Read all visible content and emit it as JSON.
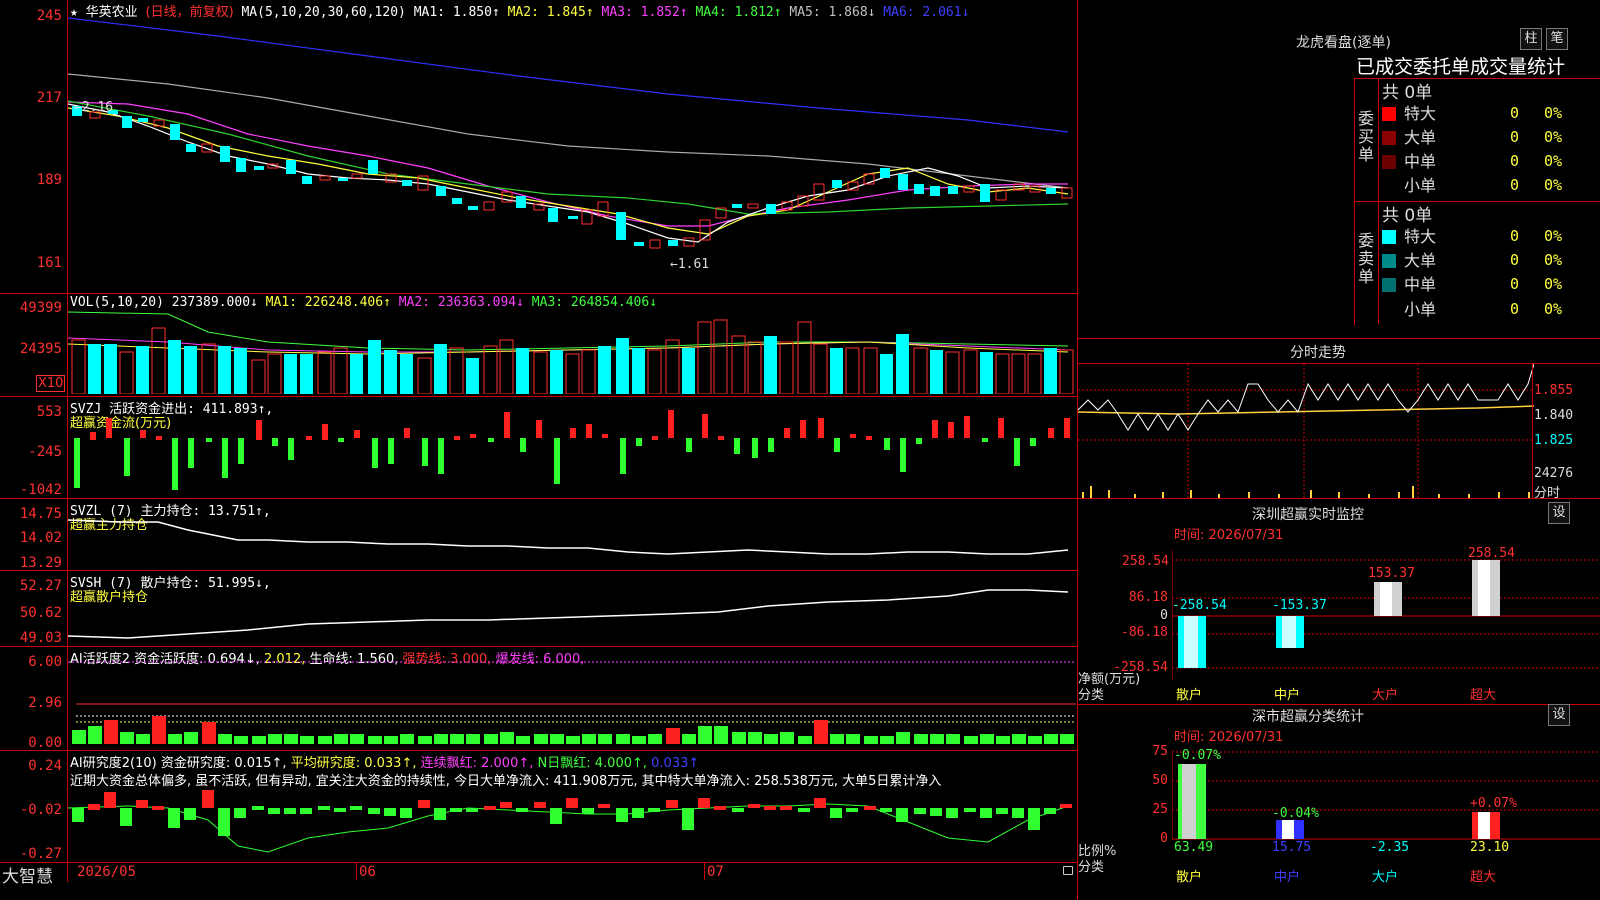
{
  "main_chart": {
    "stock_name": "华英农业",
    "period_note": "(日线，前复权)",
    "ma_label": "MA(5,10,20,30,60,120)",
    "ma_values": [
      {
        "text": "MA1: 1.850↑",
        "color": "#ffffff"
      },
      {
        "text": "MA2: 1.845↑",
        "color": "#ffff40"
      },
      {
        "text": "MA3: 1.852↑",
        "color": "#ff40ff"
      },
      {
        "text": "MA4: 1.812↑",
        "color": "#40ff40"
      },
      {
        "text": "MA5: 1.868↓",
        "color": "#c0c0c0"
      },
      {
        "text": "MA6: 2.061↓",
        "color": "#4040ff"
      }
    ],
    "y_labels": [
      "245",
      "217",
      "189",
      "161"
    ],
    "high_marker": "←2.16",
    "low_marker": "←1.61"
  },
  "vol_panel": {
    "title": "VOL(5,10,20)",
    "items": [
      {
        "text": "237389.000↓",
        "color": "#ffffff"
      },
      {
        "text": "MA1: 226248.406↑",
        "color": "#ffff40"
      },
      {
        "text": "MA2: 236363.094↓",
        "color": "#ff40ff"
      },
      {
        "text": "MA3: 264854.406↓",
        "color": "#40ff40"
      }
    ],
    "y_labels": [
      "49399",
      "24395"
    ],
    "unit": "X10"
  },
  "svzj_panel": {
    "title": "SVZJ  活跃资金进出: 411.893↑,",
    "subtitle": "超赢资金流(万元)",
    "y_labels": [
      "553",
      "-245",
      "-1042"
    ]
  },
  "svzl_panel": {
    "title": "SVZL (7) 主力持仓: 13.751↑,",
    "subtitle": "超赢主力持仓",
    "y_labels": [
      "14.75",
      "14.02",
      "13.29"
    ]
  },
  "svsh_panel": {
    "title": "SVSH (7) 散户持仓: 51.995↓,",
    "subtitle": "超赢散户持仓",
    "y_labels": [
      "52.27",
      "50.62",
      "49.03"
    ]
  },
  "ai_active_panel": {
    "title": "AI活跃度2 资金活跃度: 0.694↓,",
    "v2": "2.012,",
    "v3": "生命线: 1.560,",
    "v4": "强势线: 3.000,",
    "v5": "爆发线: 6.000,",
    "y_labels": [
      "6.00",
      "2.96",
      "0.00"
    ]
  },
  "ai_research_panel": {
    "title": "AI研究度2(10) 资金研究度: 0.015↑,",
    "v2": "平均研究度: 0.033↑,",
    "v3": "连续飘红: 2.000↑,",
    "v4": "N日飘红: 4.000↑,",
    "v5": "0.033↑",
    "comment": "近期大资金总体偏多, 虽不活跃, 但有异动, 宜关注大资金的持续性, 今日大单净流入: 411.908万元, 其中特大单净流入: 258.538万元, 大单5日累计净入",
    "y_labels": [
      "0.24",
      "-0.02",
      "-0.27"
    ]
  },
  "bottom_axis": {
    "brand": "大智慧",
    "dates": [
      "2026/05",
      "06",
      "07"
    ]
  },
  "right_panel": {
    "dragon_title": "龙虎看盘(逐单)",
    "btn_bar": "柱",
    "btn_pen": "笔",
    "stat_header": "已成交委托单成交量统计",
    "buy": {
      "side": "委买单",
      "count": "共 0单",
      "rows": [
        {
          "label": "特大",
          "value": "0",
          "pct": "0%",
          "color": "#ff0000"
        },
        {
          "label": "大单",
          "value": "0",
          "pct": "0%",
          "color": "#8b0000"
        },
        {
          "label": "中单",
          "value": "0",
          "pct": "0%",
          "color": "#6b0000"
        },
        {
          "label": "小单",
          "value": "0",
          "pct": "0%",
          "color": "#000000"
        }
      ]
    },
    "sell": {
      "side": "委卖单",
      "count": "共 0单",
      "rows": [
        {
          "label": "特大",
          "value": "0",
          "pct": "0%",
          "color": "#00ffff"
        },
        {
          "label": "大单",
          "value": "0",
          "pct": "0%",
          "color": "#008b8b"
        },
        {
          "label": "中单",
          "value": "0",
          "pct": "0%",
          "color": "#007070"
        },
        {
          "label": "小单",
          "value": "0",
          "pct": "0%",
          "color": "#000000"
        }
      ]
    },
    "intraday": {
      "title": "分时走势",
      "y_labels": [
        "1.855",
        "1.840",
        "1.825"
      ],
      "vol_label": "24276",
      "unit": "分时"
    },
    "monitor": {
      "title": "深圳超赢实时监控",
      "btn": "设",
      "time": "时间: 2026/07/31",
      "y_labels": [
        "258.54",
        "86.18",
        "0",
        "-86.18",
        "-258.54"
      ],
      "bar_labels": [
        "-258.54",
        "-153.37",
        "153.37",
        "258.54"
      ],
      "net_label": "净额(万元)",
      "cat_label": "分类",
      "cats": [
        "散户",
        "中户",
        "大户",
        "超大"
      ]
    },
    "classify": {
      "title": "深市超赢分类统计",
      "btn": "设",
      "time": "时间: 2026/07/31",
      "y_labels": [
        "75",
        "50",
        "25",
        "0"
      ],
      "top_labels": [
        "-0.07%",
        "-0.04%",
        "+0.07%"
      ],
      "values": [
        "63.49",
        "15.75",
        "-2.35",
        "23.10"
      ],
      "ratio_label": "比例%",
      "cat_label": "分类",
      "cats": [
        "散户",
        "中户",
        "大户",
        "超大"
      ]
    }
  }
}
